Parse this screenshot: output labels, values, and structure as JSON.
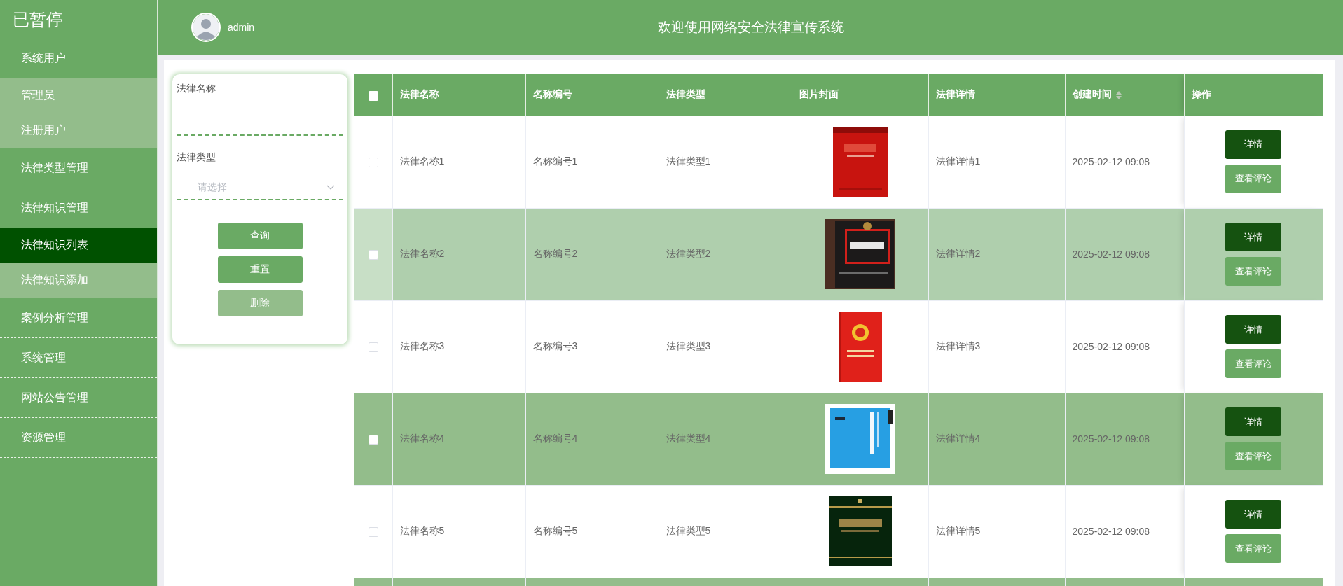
{
  "sidebar": {
    "brand": "已暂停",
    "items": [
      {
        "label": "系统用户",
        "selected": false,
        "expanded": true,
        "children": [
          {
            "label": "管理员",
            "selected": false
          },
          {
            "label": "注册用户",
            "selected": false
          }
        ]
      },
      {
        "label": "法律类型管理",
        "selected": false
      },
      {
        "label": "法律知识管理",
        "selected": false,
        "expanded": true,
        "children": [
          {
            "label": "法律知识列表",
            "selected": true
          },
          {
            "label": "法律知识添加",
            "selected": false
          }
        ]
      },
      {
        "label": "案例分析管理",
        "selected": false
      },
      {
        "label": "系统管理",
        "selected": false
      },
      {
        "label": "网站公告管理",
        "selected": false
      },
      {
        "label": "资源管理",
        "selected": false
      }
    ]
  },
  "header": {
    "user": "admin",
    "title": "欢迎使用网络安全法律宣传系统"
  },
  "search": {
    "fields": [
      {
        "kind": "text",
        "label": "法律名称"
      },
      {
        "kind": "select",
        "label": "法律类型",
        "placeholder": "请选择"
      }
    ],
    "buttons": [
      {
        "label": "查询",
        "disabled": false
      },
      {
        "label": "重置",
        "disabled": false
      },
      {
        "label": "删除",
        "disabled": true
      }
    ]
  },
  "table": {
    "all_checked": false,
    "columns": [
      {
        "label": "法律名称",
        "sortable": false
      },
      {
        "label": "名称编号",
        "sortable": false
      },
      {
        "label": "法律类型",
        "sortable": false
      },
      {
        "label": "图片封面",
        "sortable": false
      },
      {
        "label": "法律详情",
        "sortable": false
      },
      {
        "label": "创建时间",
        "sortable": true
      },
      {
        "label": "操作",
        "sortable": false
      }
    ],
    "rows": [
      {
        "checked": false,
        "hovered": false,
        "name": "法律名称1",
        "code": "名称编号1",
        "type": "法律类型1",
        "cover": {
          "kind": "picture"
        },
        "detail": "法律详情1",
        "time": "2025-02-12 09:08",
        "actions": [
          "详情",
          "查看评论"
        ]
      },
      {
        "checked": false,
        "hovered": true,
        "name": "法律名称2",
        "code": "名称编号2",
        "type": "法律类型2",
        "cover": {
          "kind": "picture"
        },
        "detail": "法律详情2",
        "time": "2025-02-12 09:08",
        "actions": [
          "详情",
          "查看评论"
        ]
      },
      {
        "checked": false,
        "hovered": false,
        "name": "法律名称3",
        "code": "名称编号3",
        "type": "法律类型3",
        "cover": {
          "kind": "picture"
        },
        "detail": "法律详情3",
        "time": "2025-02-12 09:08",
        "actions": [
          "详情",
          "查看评论"
        ]
      },
      {
        "checked": false,
        "hovered": false,
        "name": "法律名称4",
        "code": "名称编号4",
        "type": "法律类型4",
        "cover": {
          "kind": "picture"
        },
        "detail": "法律详情4",
        "time": "2025-02-12 09:08",
        "actions": [
          "详情",
          "查看评论"
        ]
      },
      {
        "checked": false,
        "hovered": false,
        "name": "法律名称5",
        "code": "名称编号5",
        "type": "法律类型5",
        "cover": {
          "kind": "picture"
        },
        "detail": "法律详情5",
        "time": "2025-02-12 09:08",
        "actions": [
          "详情",
          "查看评论"
        ]
      }
    ]
  }
}
